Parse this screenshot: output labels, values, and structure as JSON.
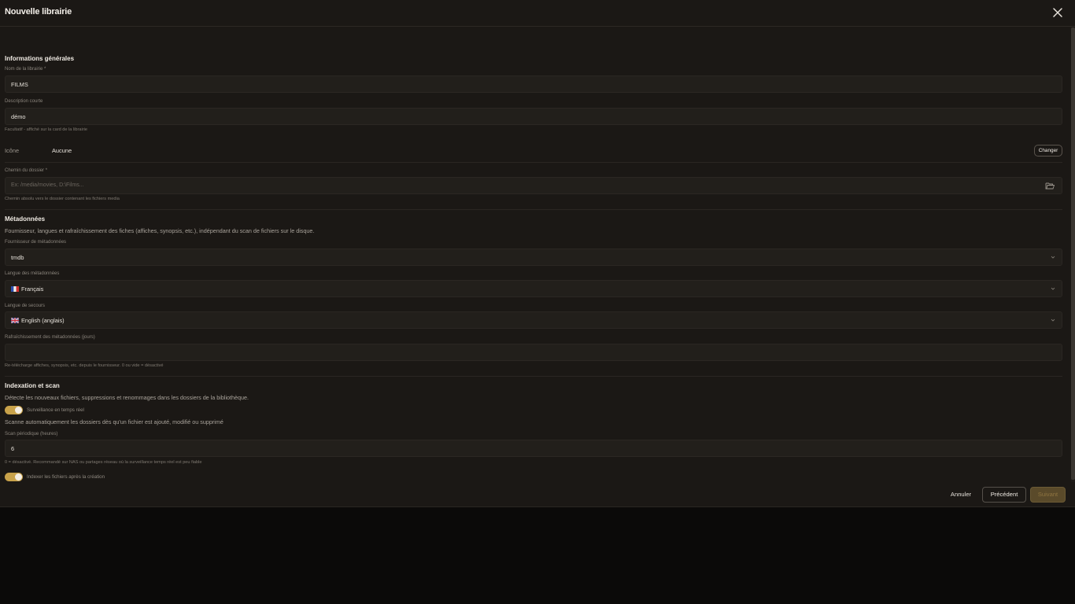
{
  "modal": {
    "title": "Nouvelle librairie"
  },
  "general": {
    "title": "Informations générales",
    "name_label": "Nom de la librairie *",
    "name_value": "FILMS",
    "desc_label": "Description courte",
    "desc_value": "démo",
    "desc_hint": "Facultatif - affiché sur la card de la librairie",
    "icon_label": "Icône",
    "icon_value": "Aucune",
    "icon_change": "Changer",
    "path_label": "Chemin du dossier *",
    "path_placeholder": "Ex: /media/movies, D:\\Films...",
    "path_hint": "Chemin absolu vers le dossier contenant les fichiers media"
  },
  "metadata": {
    "title": "Métadonnées",
    "description": "Fournisseur, langues et rafraîchissement des fiches (affiches, synopsis, etc.), indépendant du scan de fichiers sur le disque.",
    "provider_label": "Fournisseur de métadonnées",
    "provider_value": "tmdb",
    "lang_label": "Langue des métadonnées",
    "lang_value": "Français",
    "fallback_label": "Langue de secours",
    "fallback_value": "English (anglais)",
    "refresh_label": "Rafraîchissement des métadonnées (jours)",
    "refresh_value": "",
    "refresh_hint": "Re-télécharge affiches, synopsis, etc. depuis le fournisseur. 0 ou vide = désactivé"
  },
  "scan": {
    "title": "Indexation et scan",
    "description": "Détecte les nouveaux fichiers, suppressions et renommages dans les dossiers de la bibliothèque.",
    "realtime_label": "Surveillance en temps réel",
    "realtime_desc": "Scanne automatiquement les dossiers dès qu'un fichier est ajouté, modifié ou supprimé",
    "realtime_on": true,
    "periodic_label": "Scan périodique (heures)",
    "periodic_value": "6",
    "periodic_hint": "0 = désactivé. Recommandé sur NAS ou partages réseau où la surveillance temps réel est peu fiable",
    "index_label": "Indexer les fichiers après la création",
    "index_on": true
  },
  "footer": {
    "cancel": "Annuler",
    "previous": "Précédent",
    "next": "Suivant"
  },
  "colors": {
    "accent": "#c8a24a",
    "background": "#1b1815",
    "page": "#0b0a09"
  }
}
